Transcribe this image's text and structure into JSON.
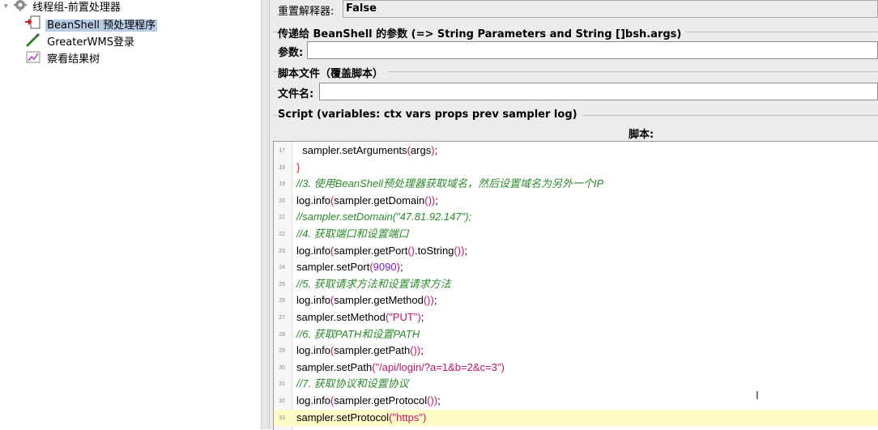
{
  "tree": {
    "items": [
      {
        "label": "线程组-前置处理器",
        "icon": "thread-group-gear-icon"
      },
      {
        "label": "BeanShell 预处理程序",
        "icon": "beanshell-preprocessor-icon",
        "selected": true
      },
      {
        "label": "GreaterWMS登录",
        "icon": "http-sampler-pipette-icon"
      },
      {
        "label": "察看结果树",
        "icon": "result-tree-chart-icon"
      }
    ]
  },
  "form": {
    "reset_label": "重置解释器:",
    "reset_value": "False",
    "params_legend": "传递给 BeanShell 的参数 (=> String Parameters and String []bsh.args)",
    "params_label": "参数:",
    "file_legend": "脚本文件（覆盖脚本）",
    "file_label": "文件名:",
    "script_legend": "Script (variables: ctx vars props prev sampler log)",
    "script_header": "脚本:"
  },
  "editor": {
    "lines": [
      {
        "n": "17",
        "parts": [
          {
            "t": "  sampler.setArguments",
            "c": "default"
          },
          {
            "t": "(",
            "c": "paren"
          },
          {
            "t": "args",
            "c": "default"
          },
          {
            "t": ")",
            "c": "paren"
          },
          {
            "t": ";",
            "c": "default"
          }
        ]
      },
      {
        "n": "18",
        "parts": [
          {
            "t": "}",
            "c": "brace"
          }
        ]
      },
      {
        "n": "19",
        "parts": [
          {
            "t": "//3. 使用BeanShell预处理器获取域名，然后设置域名为另外一个IP",
            "c": "comment"
          }
        ]
      },
      {
        "n": "20",
        "parts": [
          {
            "t": "log.info",
            "c": "default"
          },
          {
            "t": "(",
            "c": "paren"
          },
          {
            "t": "sampler.getDomain",
            "c": "default"
          },
          {
            "t": "())",
            "c": "paren"
          },
          {
            "t": ";",
            "c": "default"
          }
        ]
      },
      {
        "n": "21",
        "parts": [
          {
            "t": "//sampler.setDomain(\"47.81.92.147\");",
            "c": "comment"
          }
        ]
      },
      {
        "n": "22",
        "parts": [
          {
            "t": "//4. 获取端口和设置端口",
            "c": "comment"
          }
        ]
      },
      {
        "n": "23",
        "parts": [
          {
            "t": "log.info",
            "c": "default"
          },
          {
            "t": "(",
            "c": "paren"
          },
          {
            "t": "sampler.getPort",
            "c": "default"
          },
          {
            "t": "()",
            "c": "paren"
          },
          {
            "t": ".toString",
            "c": "default"
          },
          {
            "t": "())",
            "c": "paren"
          },
          {
            "t": ";",
            "c": "default"
          }
        ]
      },
      {
        "n": "24",
        "parts": [
          {
            "t": "sampler.setPort",
            "c": "default"
          },
          {
            "t": "(",
            "c": "paren"
          },
          {
            "t": "9090",
            "c": "number"
          },
          {
            "t": ")",
            "c": "paren"
          },
          {
            "t": ";",
            "c": "default"
          }
        ]
      },
      {
        "n": "25",
        "parts": [
          {
            "t": "//5. 获取请求方法和设置请求方法",
            "c": "comment"
          }
        ]
      },
      {
        "n": "26",
        "parts": [
          {
            "t": "log.info",
            "c": "default"
          },
          {
            "t": "(",
            "c": "paren"
          },
          {
            "t": "sampler.getMethod",
            "c": "default"
          },
          {
            "t": "())",
            "c": "paren"
          },
          {
            "t": ";",
            "c": "default"
          }
        ]
      },
      {
        "n": "27",
        "parts": [
          {
            "t": "sampler.setMethod",
            "c": "default"
          },
          {
            "t": "(",
            "c": "paren"
          },
          {
            "t": "\"PUT\"",
            "c": "string"
          },
          {
            "t": ")",
            "c": "paren"
          },
          {
            "t": ";",
            "c": "default"
          }
        ]
      },
      {
        "n": "28",
        "parts": [
          {
            "t": "//6. 获取PATH和设置PATH",
            "c": "comment"
          }
        ]
      },
      {
        "n": "29",
        "parts": [
          {
            "t": "log.info",
            "c": "default"
          },
          {
            "t": "(",
            "c": "paren"
          },
          {
            "t": "sampler.getPath",
            "c": "default"
          },
          {
            "t": "())",
            "c": "paren"
          },
          {
            "t": ";",
            "c": "default"
          }
        ]
      },
      {
        "n": "30",
        "parts": [
          {
            "t": "sampler.setPath",
            "c": "default"
          },
          {
            "t": "(",
            "c": "paren"
          },
          {
            "t": "\"/api/login/?a=1&b=2&c=3\"",
            "c": "string"
          },
          {
            "t": ")",
            "c": "paren"
          }
        ]
      },
      {
        "n": "31",
        "parts": [
          {
            "t": "//7. 获取协议和设置协议",
            "c": "comment"
          }
        ]
      },
      {
        "n": "32",
        "parts": [
          {
            "t": "log.info",
            "c": "default"
          },
          {
            "t": "(",
            "c": "paren"
          },
          {
            "t": "sampler.getProtocol",
            "c": "default"
          },
          {
            "t": "())",
            "c": "paren"
          },
          {
            "t": ";",
            "c": "default"
          }
        ]
      },
      {
        "n": "33",
        "parts": [
          {
            "t": "sampler.setProtocol",
            "c": "default"
          },
          {
            "t": "(",
            "c": "paren"
          },
          {
            "t": "\"https\"",
            "c": "string"
          },
          {
            "t": ")",
            "c": "paren"
          }
        ],
        "current": true
      }
    ]
  }
}
